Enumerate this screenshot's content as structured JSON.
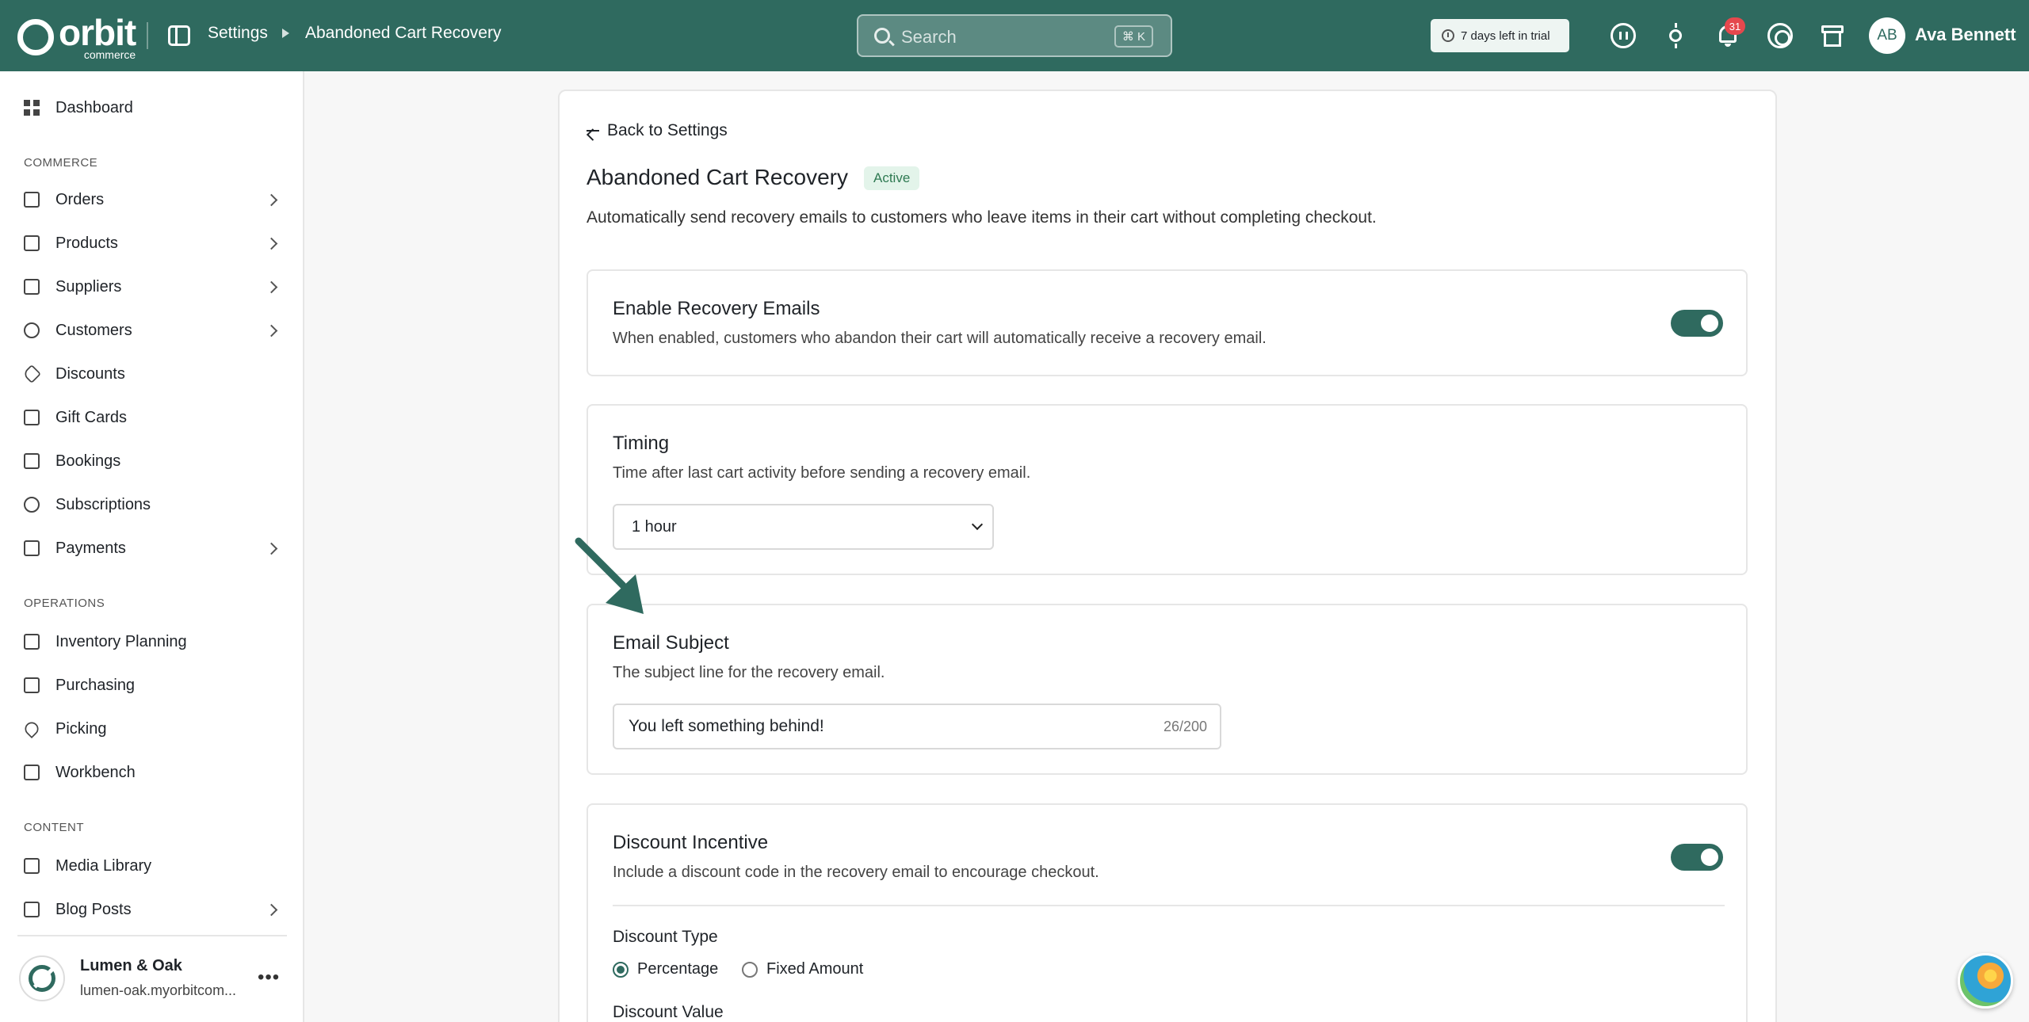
{
  "app": {
    "logo_word": "orbit",
    "logo_sub": "commerce"
  },
  "header": {
    "breadcrumb": [
      "Settings",
      "Abandoned Cart Recovery"
    ],
    "search_placeholder": "Search",
    "search_shortcut": "⌘ K",
    "trial_label": "7 days left in trial",
    "notifications_count": "31",
    "user_initials": "AB",
    "user_name": "Ava Bennett",
    "icons": [
      "sidebar-toggle-icon",
      "ai-assistant-icon",
      "sun-icon",
      "bell-icon",
      "help-icon",
      "store-icon"
    ]
  },
  "sidebar": {
    "top": [
      {
        "label": "Dashboard",
        "icon": "dashboard-icon"
      }
    ],
    "sections": [
      {
        "title": "COMMERCE",
        "items": [
          {
            "label": "Orders",
            "expandable": true
          },
          {
            "label": "Products",
            "expandable": true
          },
          {
            "label": "Suppliers",
            "expandable": true
          },
          {
            "label": "Customers",
            "expandable": true
          },
          {
            "label": "Discounts",
            "expandable": false
          },
          {
            "label": "Gift Cards",
            "expandable": false
          },
          {
            "label": "Bookings",
            "expandable": false
          },
          {
            "label": "Subscriptions",
            "expandable": false
          },
          {
            "label": "Payments",
            "expandable": true
          }
        ]
      },
      {
        "title": "OPERATIONS",
        "items": [
          {
            "label": "Inventory Planning",
            "expandable": false
          },
          {
            "label": "Purchasing",
            "expandable": false
          },
          {
            "label": "Picking",
            "expandable": false
          },
          {
            "label": "Workbench",
            "expandable": false
          }
        ]
      },
      {
        "title": "CONTENT",
        "items": [
          {
            "label": "Media Library",
            "expandable": false
          },
          {
            "label": "Blog Posts",
            "expandable": true
          }
        ]
      }
    ],
    "store": {
      "name": "Lumen & Oak",
      "url": "lumen-oak.myorbitcom..."
    }
  },
  "main": {
    "back_label": "Back to Settings",
    "title": "Abandoned Cart Recovery",
    "status": "Active",
    "description": "Automatically send recovery emails to customers who leave items in their cart without completing checkout.",
    "enable": {
      "title": "Enable Recovery Emails",
      "description": "When enabled, customers who abandon their cart will automatically receive a recovery email.",
      "enabled": true
    },
    "timing": {
      "title": "Timing",
      "description": "Time after last cart activity before sending a recovery email.",
      "selected": "1 hour"
    },
    "subject": {
      "title": "Email Subject",
      "description": "The subject line for the recovery email.",
      "value": "You left something behind!",
      "counter": "26/200"
    },
    "discount": {
      "title": "Discount Incentive",
      "description": "Include a discount code in the recovery email to encourage checkout.",
      "enabled": true,
      "type_label": "Discount Type",
      "options": [
        "Percentage",
        "Fixed Amount"
      ],
      "selected": "Percentage",
      "value_label": "Discount Value"
    }
  },
  "colors": {
    "brand": "#2f6a5f",
    "active_badge_bg": "#e3f4ea",
    "active_badge_text": "#2f7a52",
    "notification_badge": "#e5484d"
  }
}
